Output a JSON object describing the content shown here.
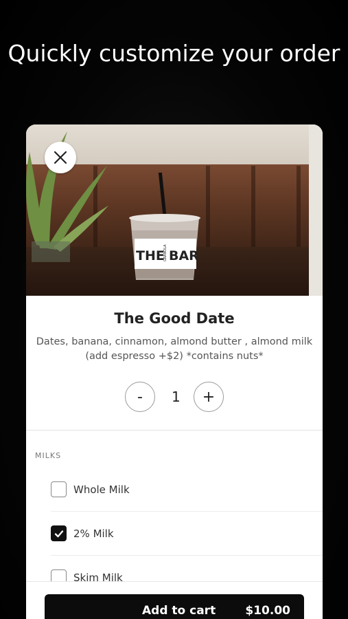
{
  "headline": "Quickly customize your order",
  "product": {
    "name": "The Good Date",
    "description": "Dates, banana, cinnamon, almond butter , almond milk (add espresso +$2) *contains nuts*",
    "cup_brand_left": "THE",
    "cup_brand_small": "GRANOLA",
    "cup_brand_right": "BAR"
  },
  "quantity": {
    "decrement_label": "-",
    "value": "1",
    "increment_label": "+"
  },
  "section": {
    "label": "MILKS",
    "options": [
      {
        "label": "Whole Milk",
        "checked": false
      },
      {
        "label": "2% Milk",
        "checked": true
      },
      {
        "label": "Skim Milk",
        "checked": false
      }
    ]
  },
  "cart": {
    "button_label": "Add to cart",
    "price": "$10.00"
  },
  "icons": {
    "close": "close-icon",
    "check": "checkmark-icon"
  },
  "colors": {
    "button_bg": "#0c0c0c",
    "checked_bg": "#111111"
  }
}
